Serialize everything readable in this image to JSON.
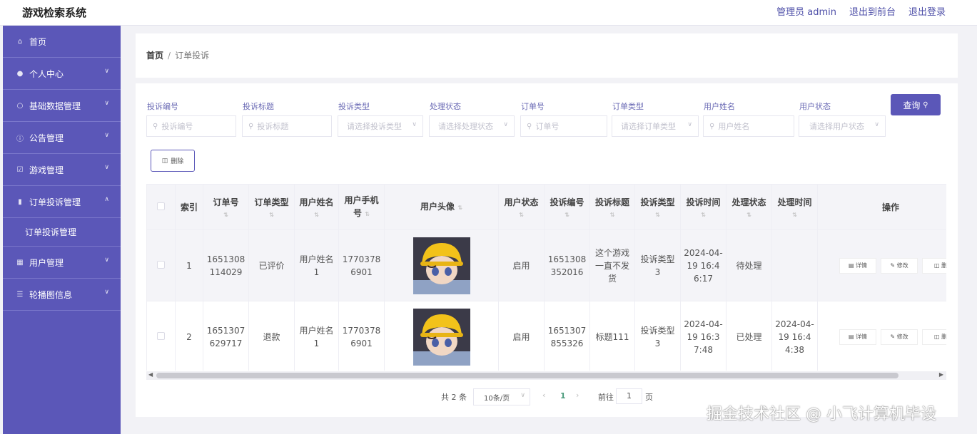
{
  "header": {
    "app_title": "游戏检索系统",
    "admin_label": "管理员 admin",
    "back_to_front": "退出到前台",
    "logout": "退出登录"
  },
  "sidebar": {
    "items": [
      {
        "label": "首页",
        "icon": "home-icon"
      },
      {
        "label": "个人中心",
        "icon": "person-icon"
      },
      {
        "label": "基础数据管理",
        "icon": "bulb-icon"
      },
      {
        "label": "公告管理",
        "icon": "info-icon"
      },
      {
        "label": "游戏管理",
        "icon": "checkbox-icon"
      },
      {
        "label": "订单投诉管理",
        "icon": "bar-chart-icon"
      },
      {
        "label": "用户管理",
        "icon": "doc-icon"
      },
      {
        "label": "轮播图信息",
        "icon": "stack-icon"
      }
    ],
    "submenu_label": "订单投诉管理"
  },
  "breadcrumb": {
    "home": "首页",
    "separator": "/",
    "current": "订单投诉"
  },
  "filters": [
    {
      "label": "投诉编号",
      "placeholder": "投诉编号",
      "kind": "input"
    },
    {
      "label": "投诉标题",
      "placeholder": "投诉标题",
      "kind": "input"
    },
    {
      "label": "投诉类型",
      "placeholder": "请选择投诉类型",
      "kind": "select"
    },
    {
      "label": "处理状态",
      "placeholder": "请选择处理状态",
      "kind": "select"
    },
    {
      "label": "订单号",
      "placeholder": "订单号",
      "kind": "input"
    },
    {
      "label": "订单类型",
      "placeholder": "请选择订单类型",
      "kind": "select"
    },
    {
      "label": "用户姓名",
      "placeholder": "用户姓名",
      "kind": "input"
    },
    {
      "label": "用户状态",
      "placeholder": "请选择用户状态",
      "kind": "select"
    }
  ],
  "search_button": "查询",
  "delete_button": "删除",
  "table": {
    "columns": [
      "索引",
      "订单号",
      "订单类型",
      "用户姓名",
      "用户手机号",
      "用户头像",
      "用户状态",
      "投诉编号",
      "投诉标题",
      "投诉类型",
      "投诉时间",
      "处理状态",
      "处理时间",
      "操作"
    ],
    "rows": [
      {
        "index": "1",
        "order_no": "1651308114029",
        "order_type": "已评价",
        "user_name": "用户姓名1",
        "phone": "17703786901",
        "user_status": "启用",
        "complaint_no": "1651308352016",
        "complaint_title": "这个游戏一直不发货",
        "complaint_type": "投诉类型3",
        "complaint_time": "2024-04-19 16:46:17",
        "process_status": "待处理",
        "process_time": ""
      },
      {
        "index": "2",
        "order_no": "1651307629717",
        "order_type": "退款",
        "user_name": "用户姓名1",
        "phone": "17703786901",
        "user_status": "启用",
        "complaint_no": "1651307855326",
        "complaint_title": "标题111",
        "complaint_type": "投诉类型3",
        "complaint_time": "2024-04-19 16:37:48",
        "process_status": "已处理",
        "process_time": "2024-04-19 16:44:38"
      }
    ],
    "actions": {
      "detail": "详情",
      "edit": "修改",
      "delete": "删"
    }
  },
  "pagination": {
    "total": "共 2 条",
    "page_size": "10条/页",
    "current_page": "1",
    "goto_label": "前往",
    "goto_value": "1",
    "page_suffix": "页"
  },
  "watermark": "掘金技术社区 @ 小飞计算机毕设",
  "colors": {
    "primary": "#5b57b8",
    "sidebar": "#5b57b8",
    "link": "#4e4fa8",
    "page_active": "#4e9d7e"
  }
}
